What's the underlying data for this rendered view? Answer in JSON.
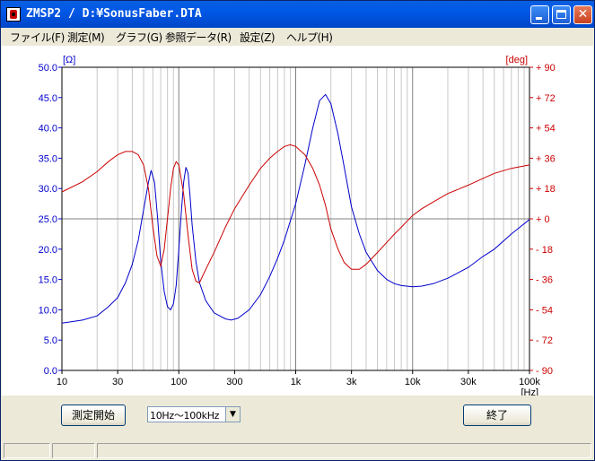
{
  "window": {
    "title": "ZMSP2 / D:¥SonusFaber.DTA"
  },
  "menu": [
    "ファイル(F)",
    "測定(M)",
    "グラフ(G)",
    "参照データ(R)",
    "設定(Z)",
    "ヘルプ(H)"
  ],
  "chart_data": {
    "type": "line",
    "left_axis_unit": "[Ω]",
    "right_axis_unit": "[deg]",
    "x_unit": "[Hz]",
    "x_scale": "log",
    "xlim": [
      10,
      100000
    ],
    "ylim_left": [
      0,
      50
    ],
    "ylim_right": [
      -90,
      90
    ],
    "x_tick_labels": [
      {
        "v": 10,
        "t": "10"
      },
      {
        "v": 30,
        "t": "30"
      },
      {
        "v": 100,
        "t": "100"
      },
      {
        "v": 300,
        "t": "300"
      },
      {
        "v": 1000,
        "t": "1k"
      },
      {
        "v": 3000,
        "t": "3k"
      },
      {
        "v": 10000,
        "t": "10k"
      },
      {
        "v": 30000,
        "t": "30k"
      },
      {
        "v": 100000,
        "t": "100k"
      }
    ],
    "left_tick_labels": [
      "0.0",
      "5.0",
      "10.0",
      "15.0",
      "20.0",
      "25.0",
      "30.0",
      "35.0",
      "40.0",
      "45.0",
      "50.0"
    ],
    "right_tick_labels": [
      "- 90",
      "- 72",
      "- 54",
      "- 36",
      "- 18",
      "+ 0",
      "+ 18",
      "+ 36",
      "+ 54",
      "+ 72",
      "+ 90"
    ],
    "series": [
      {
        "axis": "left",
        "color": "#0000CC",
        "points": [
          [
            10,
            7.8
          ],
          [
            15,
            8.3
          ],
          [
            20,
            9.0
          ],
          [
            25,
            10.5
          ],
          [
            30,
            12.0
          ],
          [
            35,
            14.5
          ],
          [
            40,
            17.5
          ],
          [
            45,
            21.5
          ],
          [
            50,
            26.5
          ],
          [
            55,
            31.0
          ],
          [
            58,
            33.0
          ],
          [
            62,
            31.0
          ],
          [
            66,
            25.0
          ],
          [
            70,
            18.0
          ],
          [
            75,
            13.0
          ],
          [
            80,
            10.5
          ],
          [
            85,
            10.0
          ],
          [
            90,
            11.0
          ],
          [
            95,
            14.0
          ],
          [
            100,
            20.0
          ],
          [
            105,
            26.0
          ],
          [
            110,
            31.0
          ],
          [
            115,
            33.5
          ],
          [
            120,
            32.5
          ],
          [
            125,
            28.5
          ],
          [
            130,
            24.0
          ],
          [
            140,
            18.0
          ],
          [
            150,
            14.5
          ],
          [
            170,
            11.5
          ],
          [
            200,
            9.5
          ],
          [
            250,
            8.5
          ],
          [
            280,
            8.3
          ],
          [
            320,
            8.6
          ],
          [
            400,
            10.0
          ],
          [
            500,
            12.5
          ],
          [
            600,
            15.5
          ],
          [
            700,
            18.5
          ],
          [
            800,
            21.5
          ],
          [
            1000,
            27.5
          ],
          [
            1200,
            34.0
          ],
          [
            1400,
            40.0
          ],
          [
            1600,
            44.5
          ],
          [
            1800,
            45.5
          ],
          [
            2000,
            44.0
          ],
          [
            2300,
            39.0
          ],
          [
            2600,
            33.5
          ],
          [
            3000,
            27.0
          ],
          [
            3500,
            22.5
          ],
          [
            4000,
            19.5
          ],
          [
            5000,
            16.5
          ],
          [
            6000,
            15.0
          ],
          [
            7000,
            14.3
          ],
          [
            8000,
            14.0
          ],
          [
            10000,
            13.8
          ],
          [
            12000,
            13.9
          ],
          [
            15000,
            14.3
          ],
          [
            20000,
            15.2
          ],
          [
            30000,
            17.0
          ],
          [
            40000,
            18.8
          ],
          [
            50000,
            20.0
          ],
          [
            70000,
            22.5
          ],
          [
            100000,
            24.9
          ]
        ]
      },
      {
        "axis": "right",
        "color": "#CC0000",
        "points": [
          [
            10,
            16.0
          ],
          [
            15,
            22.0
          ],
          [
            20,
            28.0
          ],
          [
            25,
            34.0
          ],
          [
            30,
            38.0
          ],
          [
            35,
            40.0
          ],
          [
            40,
            40.0
          ],
          [
            45,
            38.0
          ],
          [
            50,
            32.0
          ],
          [
            55,
            18.0
          ],
          [
            60,
            -5.0
          ],
          [
            65,
            -22.0
          ],
          [
            70,
            -28.0
          ],
          [
            75,
            -18.0
          ],
          [
            80,
            0.0
          ],
          [
            85,
            18.0
          ],
          [
            90,
            30.0
          ],
          [
            95,
            34.0
          ],
          [
            100,
            32.0
          ],
          [
            110,
            15.0
          ],
          [
            120,
            -10.0
          ],
          [
            130,
            -30.0
          ],
          [
            140,
            -37.0
          ],
          [
            150,
            -38.0
          ],
          [
            170,
            -30.0
          ],
          [
            200,
            -20.0
          ],
          [
            250,
            -5.0
          ],
          [
            300,
            6.0
          ],
          [
            400,
            20.0
          ],
          [
            500,
            30.0
          ],
          [
            600,
            36.0
          ],
          [
            700,
            40.0
          ],
          [
            800,
            43.0
          ],
          [
            900,
            44.0
          ],
          [
            1000,
            43.0
          ],
          [
            1200,
            38.0
          ],
          [
            1400,
            30.0
          ],
          [
            1600,
            20.0
          ],
          [
            1800,
            8.0
          ],
          [
            2000,
            -6.0
          ],
          [
            2300,
            -18.0
          ],
          [
            2600,
            -26.0
          ],
          [
            3000,
            -30.0
          ],
          [
            3500,
            -30.0
          ],
          [
            4000,
            -27.0
          ],
          [
            5000,
            -20.0
          ],
          [
            6000,
            -14.0
          ],
          [
            7000,
            -9.0
          ],
          [
            8000,
            -5.0
          ],
          [
            10000,
            2.0
          ],
          [
            12000,
            6.0
          ],
          [
            15000,
            10.0
          ],
          [
            20000,
            15.0
          ],
          [
            30000,
            20.0
          ],
          [
            40000,
            24.0
          ],
          [
            50000,
            27.0
          ],
          [
            70000,
            30.0
          ],
          [
            100000,
            32.0
          ]
        ]
      }
    ]
  },
  "controls": {
    "start_button": "測定開始",
    "range_select": "10Hz～100kHz",
    "end_button": "終了"
  }
}
